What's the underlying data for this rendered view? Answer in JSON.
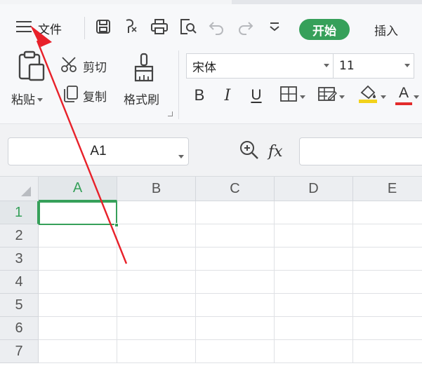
{
  "app": {
    "accent_color": "#36a05a",
    "arrow_color": "#e8212a"
  },
  "toolbar": {
    "menu_label": "文件",
    "quick_access": [
      "save-icon",
      "format-painter-quick-icon",
      "print-icon",
      "print-preview-icon",
      "undo-icon",
      "redo-icon",
      "customize-dropdown-icon"
    ],
    "tabs": [
      {
        "label": "开始",
        "active": true
      },
      {
        "label": "插入",
        "active": false
      }
    ]
  },
  "ribbon": {
    "paste_label": "粘贴",
    "cut_label": "剪切",
    "copy_label": "复制",
    "format_painter_label": "格式刷",
    "font_name": "宋体",
    "font_size": "11",
    "format_buttons": [
      "bold-icon",
      "italic-icon",
      "underline-icon",
      "borders-icon",
      "cell-style-icon",
      "fill-color-icon",
      "font-color-icon"
    ],
    "bold_glyph": "B",
    "italic_glyph": "I",
    "underline_glyph": "U",
    "font_color_glyph": "A",
    "fill_color": "#f2d21b",
    "font_color": "#e32b2b"
  },
  "formula_bar": {
    "name_box_value": "A1",
    "fx_label": "fx",
    "formula_value": ""
  },
  "sheet": {
    "columns": [
      "A",
      "B",
      "C",
      "D",
      "E"
    ],
    "rows": [
      "1",
      "2",
      "3",
      "4",
      "5",
      "6",
      "7"
    ],
    "active_cell": "A1",
    "selected_column": "A",
    "selected_row": "1"
  }
}
